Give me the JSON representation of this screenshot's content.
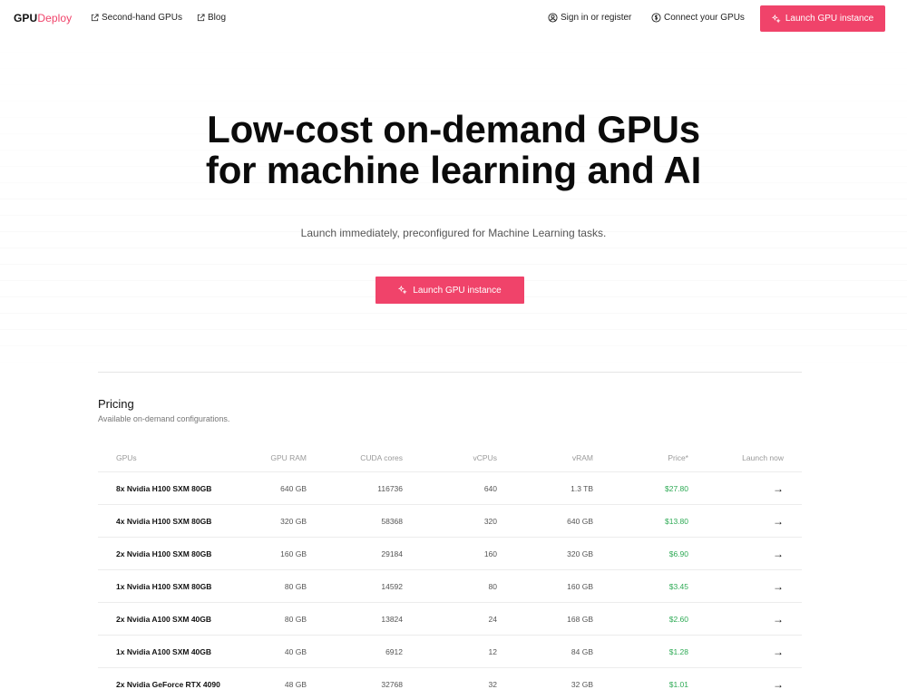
{
  "nav": {
    "logo_primary": "GPU",
    "logo_secondary": "Deploy",
    "links": [
      {
        "label": "Second-hand GPUs",
        "icon": "external-link-icon"
      },
      {
        "label": "Blog",
        "icon": "external-link-icon"
      }
    ],
    "sign_in_label": "Sign in or register",
    "connect_label": "Connect your GPUs",
    "launch_label": "Launch GPU instance"
  },
  "hero": {
    "title_line1": "Low-cost on-demand GPUs",
    "title_line2": "for machine learning and AI",
    "subtitle": "Launch immediately, preconfigured for Machine Learning tasks.",
    "cta_label": "Launch GPU instance"
  },
  "pricing": {
    "title": "Pricing",
    "subtitle": "Available on-demand configurations.",
    "columns": [
      "GPUs",
      "GPU RAM",
      "CUDA cores",
      "vCPUs",
      "vRAM",
      "Price*",
      "Launch now"
    ],
    "rows": [
      {
        "gpu": "8x Nvidia H100 SXM 80GB",
        "gpu_ram": "640 GB",
        "cuda": "116736",
        "vcpus": "640",
        "vram": "1.3 TB",
        "price": "$27.80"
      },
      {
        "gpu": "4x Nvidia H100 SXM 80GB",
        "gpu_ram": "320 GB",
        "cuda": "58368",
        "vcpus": "320",
        "vram": "640 GB",
        "price": "$13.80"
      },
      {
        "gpu": "2x Nvidia H100 SXM 80GB",
        "gpu_ram": "160 GB",
        "cuda": "29184",
        "vcpus": "160",
        "vram": "320 GB",
        "price": "$6.90"
      },
      {
        "gpu": "1x Nvidia H100 SXM 80GB",
        "gpu_ram": "80 GB",
        "cuda": "14592",
        "vcpus": "80",
        "vram": "160 GB",
        "price": "$3.45"
      },
      {
        "gpu": "2x Nvidia A100 SXM 40GB",
        "gpu_ram": "80 GB",
        "cuda": "13824",
        "vcpus": "24",
        "vram": "168 GB",
        "price": "$2.60"
      },
      {
        "gpu": "1x Nvidia A100 SXM 40GB",
        "gpu_ram": "40 GB",
        "cuda": "6912",
        "vcpus": "12",
        "vram": "84 GB",
        "price": "$1.28"
      },
      {
        "gpu": "2x Nvidia GeForce RTX 4090",
        "gpu_ram": "48 GB",
        "cuda": "32768",
        "vcpus": "32",
        "vram": "32 GB",
        "price": "$1.01"
      }
    ],
    "arrow_glyph": "→"
  },
  "colors": {
    "accent": "#f0436a",
    "price_green": "#2eaa55"
  }
}
